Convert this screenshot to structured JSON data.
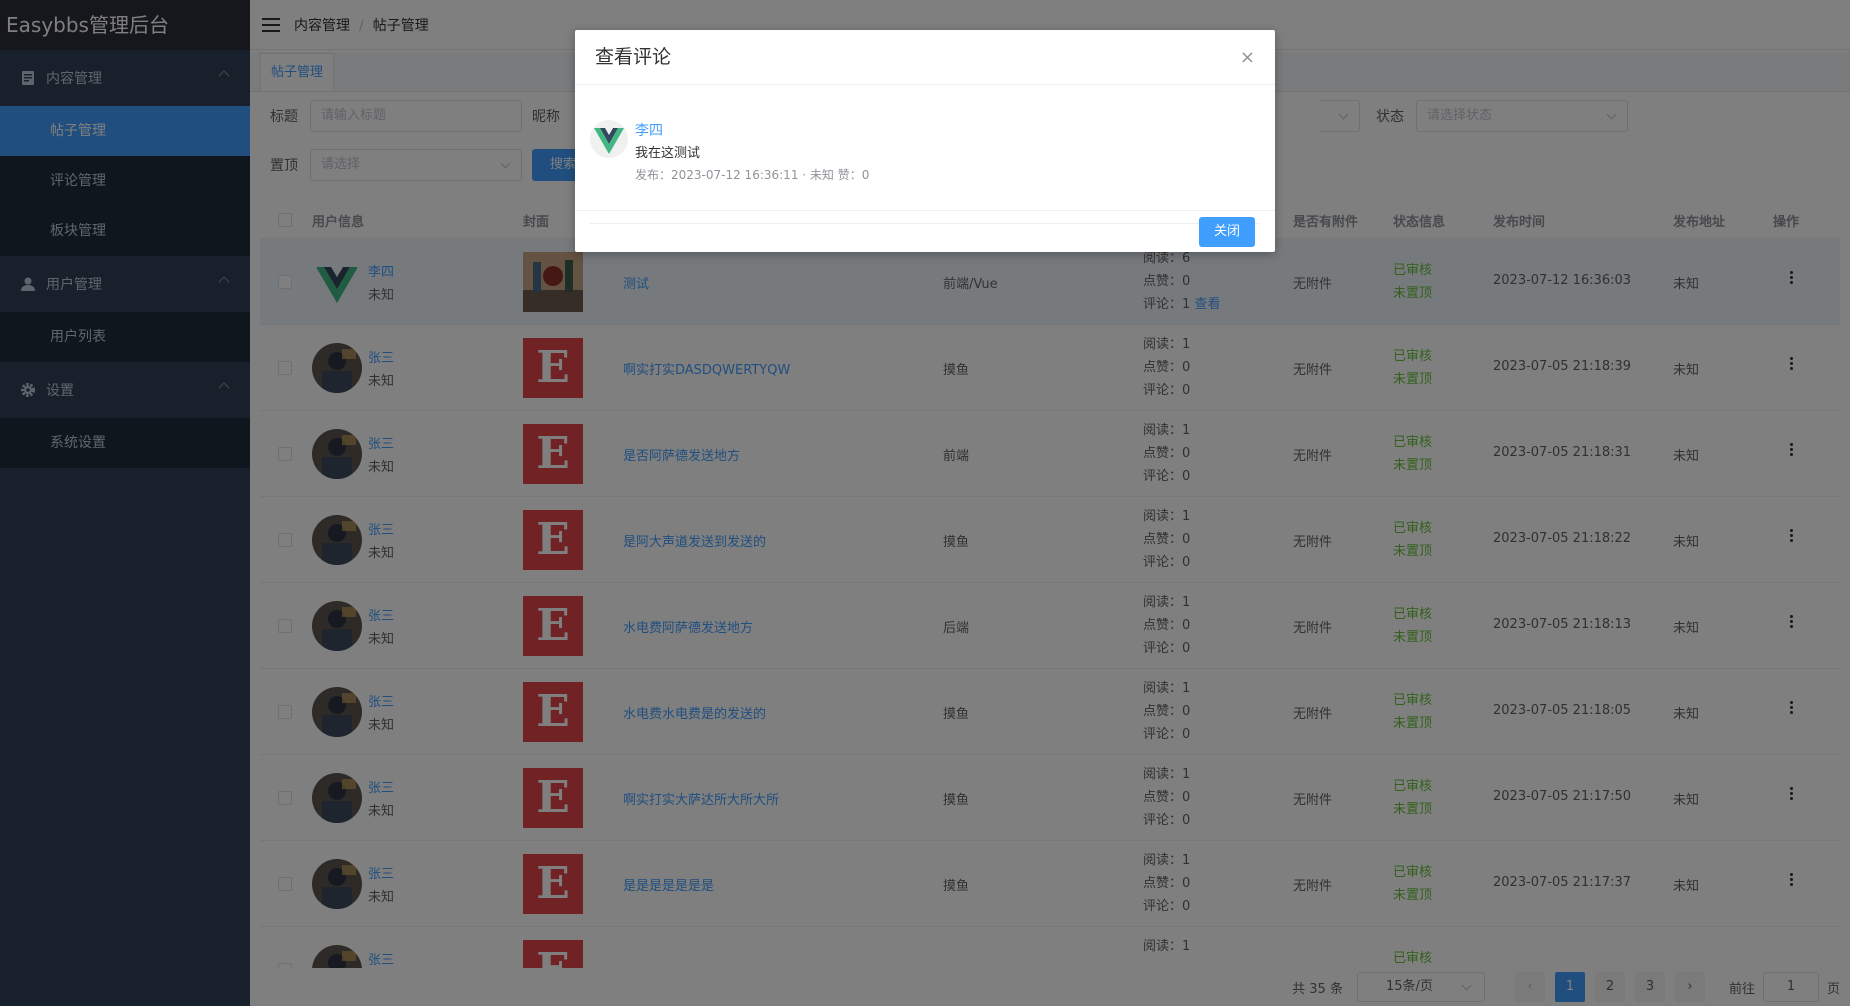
{
  "app": {
    "title": "Easybbs管理后台"
  },
  "sidebar": {
    "groups": [
      {
        "label": "内容管理",
        "icon": "document-icon",
        "items": [
          {
            "label": "帖子管理",
            "active": true
          },
          {
            "label": "评论管理"
          },
          {
            "label": "板块管理"
          }
        ]
      },
      {
        "label": "用户管理",
        "icon": "user-icon",
        "items": [
          {
            "label": "用户列表"
          }
        ]
      },
      {
        "label": "设置",
        "icon": "gear-icon",
        "items": [
          {
            "label": "系统设置"
          }
        ]
      }
    ]
  },
  "breadcrumb": {
    "level1": "内容管理",
    "separator": "/",
    "level2": "帖子管理"
  },
  "tabs": [
    {
      "label": "帖子管理",
      "active": true
    }
  ],
  "filters": {
    "title_label": "标题",
    "title_placeholder": "请输入标题",
    "nickname_label": "昵称",
    "status_label": "状态",
    "status_placeholder": "请选择状态",
    "top_label": "置顶",
    "top_placeholder": "请选择",
    "search_button": "搜索"
  },
  "table": {
    "headers": [
      "用户信息",
      "封面",
      "是否有附件",
      "状态信息",
      "发布时间",
      "发布地址",
      "操作"
    ],
    "stat_labels": {
      "read": "阅读：",
      "like": "点赞：",
      "comment": "评论："
    },
    "view_link": "查看",
    "rows": [
      {
        "user": "李四",
        "city": "未知",
        "avatar": "vue",
        "title": "测试",
        "board": "前端/Vue",
        "read": 6,
        "like": 0,
        "comment": 1,
        "attachment": "无附件",
        "audit": "已审核",
        "top": "未置顶",
        "time": "2023-07-12 16:36:03",
        "address": "未知",
        "cover": "image",
        "highlight": true
      },
      {
        "user": "张三",
        "city": "未知",
        "avatar": "photo",
        "title": "啊实打实DASDQWERTYQW",
        "board": "摸鱼",
        "read": 1,
        "like": 0,
        "comment": 0,
        "attachment": "无附件",
        "audit": "已审核",
        "top": "未置顶",
        "time": "2023-07-05 21:18:39",
        "address": "未知",
        "cover": "E"
      },
      {
        "user": "张三",
        "city": "未知",
        "avatar": "photo",
        "title": "是否阿萨德发送地方",
        "board": "前端",
        "read": 1,
        "like": 0,
        "comment": 0,
        "attachment": "无附件",
        "audit": "已审核",
        "top": "未置顶",
        "time": "2023-07-05 21:18:31",
        "address": "未知",
        "cover": "E"
      },
      {
        "user": "张三",
        "city": "未知",
        "avatar": "photo",
        "title": "是阿大声道发送到发送的",
        "board": "摸鱼",
        "read": 1,
        "like": 0,
        "comment": 0,
        "attachment": "无附件",
        "audit": "已审核",
        "top": "未置顶",
        "time": "2023-07-05 21:18:22",
        "address": "未知",
        "cover": "E"
      },
      {
        "user": "张三",
        "city": "未知",
        "avatar": "photo",
        "title": "水电费阿萨德发送地方",
        "board": "后端",
        "read": 1,
        "like": 0,
        "comment": 0,
        "attachment": "无附件",
        "audit": "已审核",
        "top": "未置顶",
        "time": "2023-07-05 21:18:13",
        "address": "未知",
        "cover": "E"
      },
      {
        "user": "张三",
        "city": "未知",
        "avatar": "photo",
        "title": "水电费水电费是的发送的",
        "board": "摸鱼",
        "read": 1,
        "like": 0,
        "comment": 0,
        "attachment": "无附件",
        "audit": "已审核",
        "top": "未置顶",
        "time": "2023-07-05 21:18:05",
        "address": "未知",
        "cover": "E"
      },
      {
        "user": "张三",
        "city": "未知",
        "avatar": "photo",
        "title": "啊实打实大萨达所大所大所",
        "board": "摸鱼",
        "read": 1,
        "like": 0,
        "comment": 0,
        "attachment": "无附件",
        "audit": "已审核",
        "top": "未置顶",
        "time": "2023-07-05 21:17:50",
        "address": "未知",
        "cover": "E"
      },
      {
        "user": "张三",
        "city": "未知",
        "avatar": "photo",
        "title": "是是是是是是是",
        "board": "摸鱼",
        "read": 1,
        "like": 0,
        "comment": 0,
        "attachment": "无附件",
        "audit": "已审核",
        "top": "未置顶",
        "time": "2023-07-05 21:17:37",
        "address": "未知",
        "cover": "E"
      },
      {
        "user": "张三",
        "city": "",
        "avatar": "photo",
        "title": "",
        "board": "",
        "read": 1,
        "like": null,
        "comment": null,
        "attachment": "",
        "audit": "已审核",
        "top": "",
        "time": "",
        "address": "",
        "cover": "E",
        "partial": true
      }
    ]
  },
  "pagination": {
    "total": "共 35 条",
    "page_size": "15条/页",
    "pages": [
      "1",
      "2",
      "3"
    ],
    "current": "1",
    "goto_label": "前往",
    "goto_value": "1",
    "goto_suffix": "页"
  },
  "dialog": {
    "title": "查看评论",
    "close_icon": "×",
    "comment": {
      "user": "李四",
      "text": "我在这测试",
      "meta": "发布：2023-07-12 16:36:11 · 未知   赞：0"
    },
    "close_button": "关闭"
  },
  "colors": {
    "primary": "#409eff",
    "sidebar": "#304156",
    "success": "#67c23a",
    "cover": "#e0444a"
  }
}
